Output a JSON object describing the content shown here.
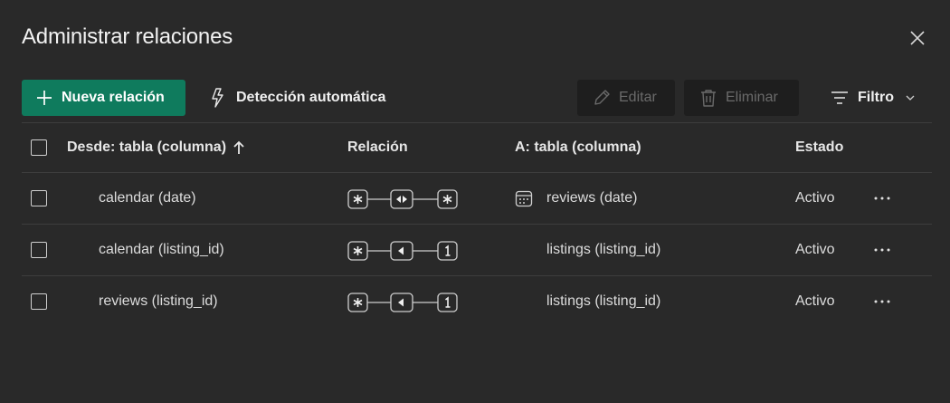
{
  "dialog": {
    "title": "Administrar relaciones"
  },
  "toolbar": {
    "new_label": "Nueva relación",
    "auto_label": "Detección automática",
    "edit_label": "Editar",
    "delete_label": "Eliminar",
    "filter_label": "Filtro"
  },
  "table": {
    "headers": {
      "from": "Desde: tabla (columna)",
      "relation": "Relación",
      "to": "A: tabla (columna)",
      "status": "Estado"
    },
    "rows": [
      {
        "from": "calendar (date)",
        "to": "reviews (date)",
        "status": "Activo",
        "cardinality": "many-to-many",
        "to_icon": "calendar-table-icon"
      },
      {
        "from": "calendar (listing_id)",
        "to": "listings (listing_id)",
        "status": "Activo",
        "cardinality": "many-to-one",
        "to_icon": ""
      },
      {
        "from": "reviews (listing_id)",
        "to": "listings (listing_id)",
        "status": "Activo",
        "cardinality": "many-to-one",
        "to_icon": ""
      }
    ]
  },
  "colors": {
    "background": "#292929",
    "primary": "#0f7b5d",
    "disabled_bg": "#1e1e1e"
  }
}
